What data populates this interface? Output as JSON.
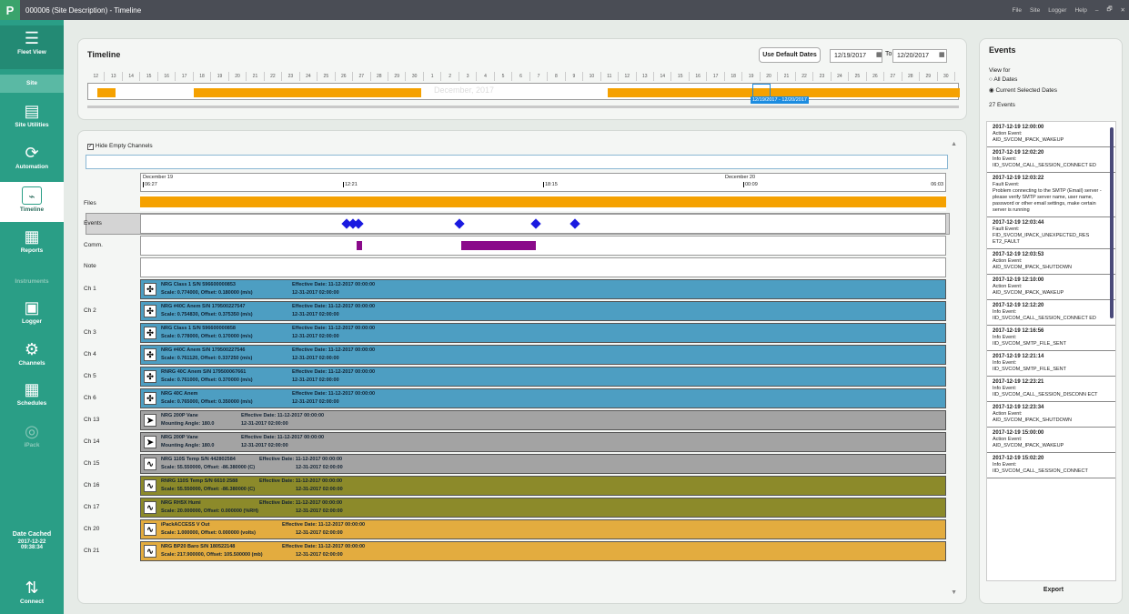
{
  "window": {
    "title": "000006 (Site Description) - Timeline",
    "menu": [
      "File",
      "Site",
      "Logger",
      "Help"
    ],
    "controls": [
      "–",
      "🗗",
      "✕"
    ],
    "logo": "P"
  },
  "sidebar": {
    "items": [
      {
        "label": "Fleet View",
        "icon": "☰"
      },
      {
        "label": "Site",
        "icon": ""
      },
      {
        "label": "Site Utilities",
        "icon": "▤"
      },
      {
        "label": "Automation",
        "icon": "⟳"
      },
      {
        "label": "Timeline",
        "icon": "⌁"
      },
      {
        "label": "Reports",
        "icon": "▦"
      },
      {
        "label": "Instruments",
        "icon": ""
      },
      {
        "label": "Logger",
        "icon": "▣"
      },
      {
        "label": "Channels",
        "icon": "⚙"
      },
      {
        "label": "Schedules",
        "icon": "▦"
      },
      {
        "label": "iPack",
        "icon": "◎"
      }
    ],
    "date_cached_label": "Date Cached",
    "date_cached_date": "2017-12-22",
    "date_cached_time": "09:38:34",
    "connect_label": "Connect",
    "connect_icon": "⇅"
  },
  "timeline": {
    "title": "Timeline",
    "default_btn": "Use Default Dates",
    "from": "12/19/2017",
    "to_label": "To",
    "to": "12/20/2017",
    "ticks": [
      "12",
      "13",
      "14",
      "15",
      "16",
      "17",
      "18",
      "19",
      "20",
      "21",
      "22",
      "23",
      "24",
      "25",
      "26",
      "27",
      "28",
      "29",
      "30",
      "1",
      "2",
      "3",
      "4",
      "5",
      "6",
      "7",
      "8",
      "9",
      "10",
      "11",
      "12",
      "13",
      "14",
      "15",
      "16",
      "17",
      "18",
      "19",
      "20",
      "21",
      "22",
      "23",
      "24",
      "25",
      "26",
      "27",
      "28",
      "29",
      "30"
    ],
    "month_watermark": "December, 2017",
    "selection_label": "12/19/2017 - 12/20/2017"
  },
  "detail": {
    "hide_empty": "Hide Empty Channels",
    "day1": "December 19",
    "day2": "December 20",
    "times": [
      "06:27",
      "12:21",
      "18:15",
      "00:09",
      "06:03"
    ],
    "rows": {
      "files": "Files",
      "events": "Events",
      "comm": "Comm.",
      "note": "Note"
    },
    "channels": [
      {
        "ch": "Ch 1",
        "l1": "NRG Class 1 S/N 596600000853",
        "l2": "Scale: 0.774000, Offset: 0.180000 (m/s)",
        "eff": "Effective Date: 11-12-2017 00:00:00",
        "exp": "12-31-2017 02:00:00",
        "color": "#4d9ec2",
        "icon": "anem"
      },
      {
        "ch": "Ch 2",
        "l1": "NRG #40C Anem S/N 179500227547",
        "l2": "Scale: 0.754830, Offset: 0.375350 (m/s)",
        "eff": "Effective Date: 11-12-2017 00:00:00",
        "exp": "12-31-2017 02:00:00",
        "color": "#4d9ec2",
        "icon": "anem"
      },
      {
        "ch": "Ch 3",
        "l1": "NRG Class 1 S/N 596600000858",
        "l2": "Scale: 0.778000, Offset: 0.170000 (m/s)",
        "eff": "Effective Date: 11-12-2017 00:00:00",
        "exp": "12-31-2017 02:00:00",
        "color": "#4d9ec2",
        "icon": "anem"
      },
      {
        "ch": "Ch 4",
        "l1": "NRG #40C Anem S/N 179500227546",
        "l2": "Scale: 0.761120, Offset: 0.337250 (m/s)",
        "eff": "Effective Date: 11-12-2017 00:00:00",
        "exp": "12-31-2017 02:00:00",
        "color": "#4d9ec2",
        "icon": "anem"
      },
      {
        "ch": "Ch 5",
        "l1": "RNRG 40C Anem S/N 179500067661",
        "l2": "Scale: 0.761000, Offset: 0.370000 (m/s)",
        "eff": "Effective Date: 11-12-2017 00:00:00",
        "exp": "12-31-2017 02:00:00",
        "color": "#4d9ec2",
        "icon": "anem"
      },
      {
        "ch": "Ch 6",
        "l1": "NRG 40C Anem",
        "l2": "Scale: 0.765000, Offset: 0.350000 (m/s)",
        "eff": "Effective Date: 11-12-2017 00:00:00",
        "exp": "12-31-2017 02:00:00",
        "color": "#4d9ec2",
        "icon": "anem"
      },
      {
        "ch": "Ch 13",
        "l1": "NRG 200P Vane",
        "l2": "Mounting Angle: 180.0",
        "eff": "Effective Date: 11-12-2017 00:00:00",
        "exp": "12-31-2017 02:00:00",
        "color": "#a3a3a3",
        "icon": "vane"
      },
      {
        "ch": "Ch 14",
        "l1": "NRG 200P Vane",
        "l2": "Mounting Angle: 180.0",
        "eff": "Effective Date: 11-12-2017 00:00:00",
        "exp": "12-31-2017 02:00:00",
        "color": "#a3a3a3",
        "icon": "vane"
      },
      {
        "ch": "Ch 15",
        "l1": "NRG 110S Temp S/N 442802584",
        "l2": "Scale: 55.550000, Offset: -86.380000 (C)",
        "eff": "Effective Date: 11-12-2017 00:00:00",
        "exp": "12-31-2017 02:00:00",
        "color": "#a3a3a3",
        "icon": "analog"
      },
      {
        "ch": "Ch 16",
        "l1": "RNRG 110S Temp S/N 6610 2588",
        "l2": "Scale: 55.550000, Offset: -86.380000 (C)",
        "eff": "Effective Date: 11-12-2017 00:00:00",
        "exp": "12-31-2017 02:00:00",
        "color": "#8c8a2a",
        "icon": "analog"
      },
      {
        "ch": "Ch 17",
        "l1": "NRG RH5X Humi",
        "l2": "Scale: 20.000000, Offset: 0.000000 (%RH)",
        "eff": "Effective Date: 11-12-2017 00:00:00",
        "exp": "12-31-2017 02:00:00",
        "color": "#8c8a2a",
        "icon": "analog"
      },
      {
        "ch": "Ch 20",
        "l1": "iPackACCESS V Out",
        "l2": "Scale: 1.000000, Offset: 0.000000 (volts)",
        "eff": "Effective Date: 11-12-2017 00:00:00",
        "exp": "12-31-2017 02:00:00",
        "color": "#e3ac3f",
        "icon": "analog"
      },
      {
        "ch": "Ch 21",
        "l1": "NRG BP20 Baro S/N 180522148",
        "l2": "Scale: 217.900000, Offset: 105.500000 (mb)",
        "eff": "Effective Date: 11-12-2017 00:00:00",
        "exp": "12-31-2017 02:00:00",
        "color": "#e3ac3f",
        "icon": "analog"
      }
    ]
  },
  "events": {
    "title": "Events",
    "view_for": "View for",
    "opt_all": "All Dates",
    "opt_current": "Current Selected Dates",
    "count": "27 Events",
    "export": "Export",
    "list": [
      {
        "t": "2017-12-19 12:00:00",
        "k": "Action Event:",
        "m": "AID_SVCOM_IPACK_WAKEUP"
      },
      {
        "t": "2017-12-19 12:02:20",
        "k": "Info Event:",
        "m": "IID_SVCOM_CALL_SESSION_CONNECT ED"
      },
      {
        "t": "2017-12-19 12:03:22",
        "k": "Fault Event:",
        "m": "Problem connecting to the SMTP (Email) server - please verify SMTP server name, user name, password or other email settings, make certain server is running"
      },
      {
        "t": "2017-12-19 12:03:44",
        "k": "Fault Event:",
        "m": "FID_SVCOM_IPACK_UNEXPECTED_RES ET2_FAULT"
      },
      {
        "t": "2017-12-19 12:03:53",
        "k": "Action Event:",
        "m": "AID_SVCOM_IPACK_SHUTDOWN"
      },
      {
        "t": "2017-12-19 12:10:00",
        "k": "Action Event:",
        "m": "AID_SVCOM_IPACK_WAKEUP"
      },
      {
        "t": "2017-12-19 12:12:20",
        "k": "Info Event:",
        "m": "IID_SVCOM_CALL_SESSION_CONNECT ED"
      },
      {
        "t": "2017-12-19 12:16:56",
        "k": "Info Event:",
        "m": "IID_SVCOM_SMTP_FILE_SENT"
      },
      {
        "t": "2017-12-19 12:21:14",
        "k": "Info Event:",
        "m": "IID_SVCOM_SMTP_FILE_SENT"
      },
      {
        "t": "2017-12-19 12:23:21",
        "k": "Info Event:",
        "m": "IID_SVCOM_CALL_SESSION_DISCONN ECT"
      },
      {
        "t": "2017-12-19 12:23:34",
        "k": "Action Event:",
        "m": "AID_SVCOM_IPACK_SHUTDOWN"
      },
      {
        "t": "2017-12-19 15:00:00",
        "k": "Action Event:",
        "m": "AID_SVCOM_IPACK_WAKEUP"
      },
      {
        "t": "2017-12-19 15:02:20",
        "k": "Info Event:",
        "m": "IID_SVCOM_CALL_SESSION_CONNECT"
      }
    ]
  }
}
